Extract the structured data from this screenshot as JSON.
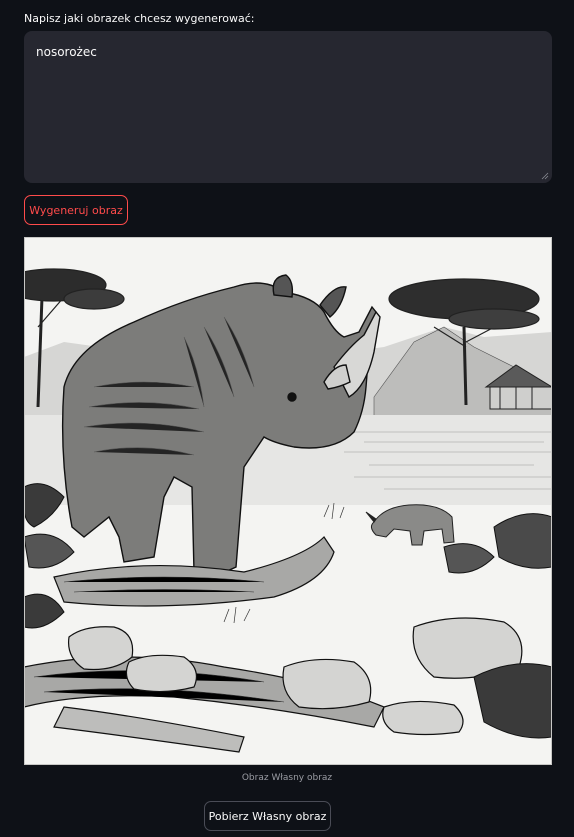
{
  "prompt": {
    "label": "Napisz jaki obrazek chcesz wygenerować:",
    "value": "nosorożec"
  },
  "generate_button": {
    "label": "Wygeneruj obraz"
  },
  "image": {
    "caption": "Obraz Własny obraz"
  },
  "download_button": {
    "label": "Pobierz Własny obraz"
  },
  "colors": {
    "background": "#0e1117",
    "input_bg": "#262730",
    "accent": "#ff4b4b"
  }
}
